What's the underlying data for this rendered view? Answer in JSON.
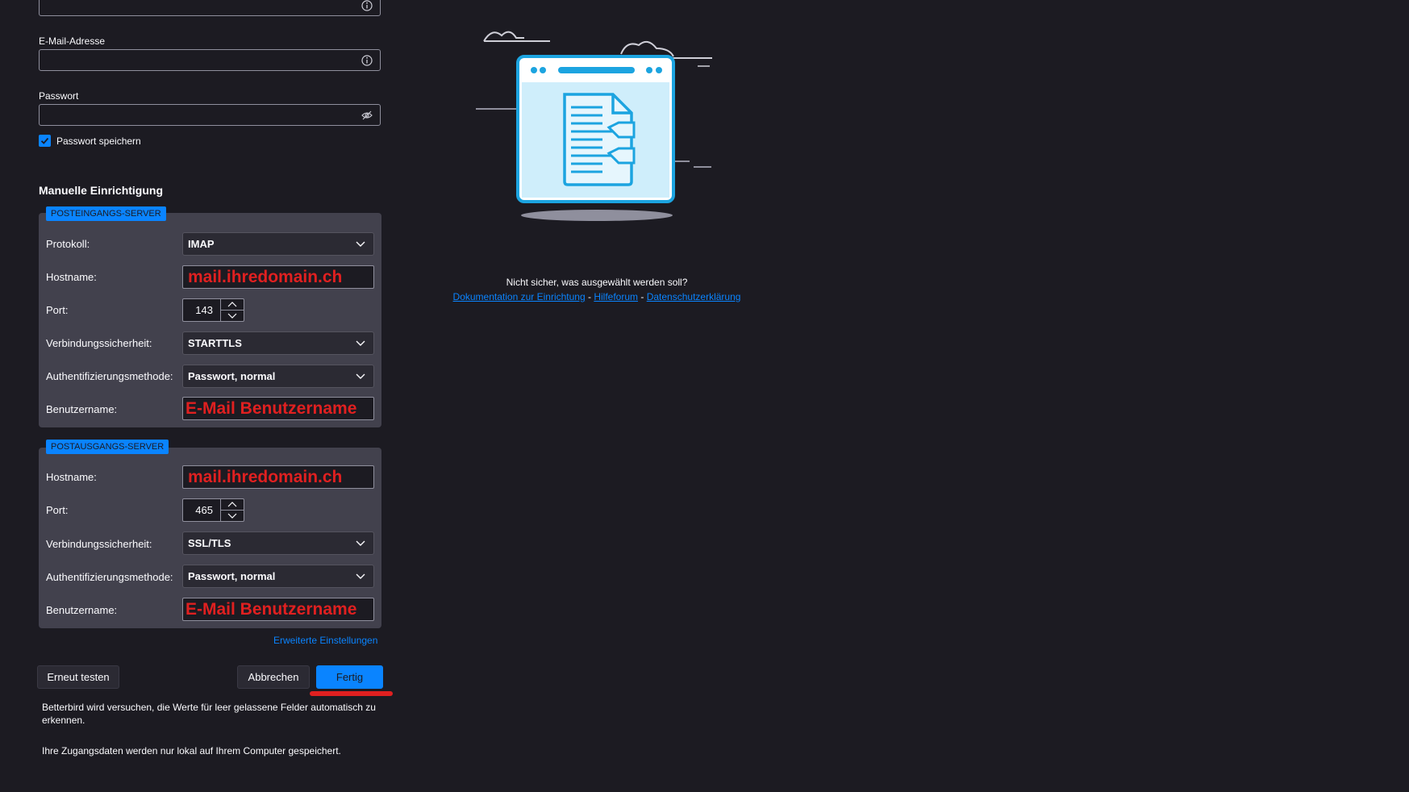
{
  "account": {
    "email_label": "E-Mail-Adresse",
    "email_value": "",
    "password_label": "Passwort",
    "password_value": "",
    "save_password_label": "Passwort speichern",
    "save_password_checked": true
  },
  "manual": {
    "title": "Manuelle Einrichtigung",
    "incoming": {
      "badge": "POSTEINGANGS-SERVER",
      "protocol_label": "Protokoll:",
      "protocol_value": "IMAP",
      "hostname_label": "Hostname:",
      "hostname_value": "mail.ihredomain.ch",
      "port_label": "Port:",
      "port_value": "143",
      "security_label": "Verbindungssicherheit:",
      "security_value": "STARTTLS",
      "auth_label": "Authentifizierungsmethode:",
      "auth_value": "Passwort, normal",
      "username_label": "Benutzername:",
      "username_value": "E-Mail Benutzername"
    },
    "outgoing": {
      "badge": "POSTAUSGANGS-SERVER",
      "hostname_label": "Hostname:",
      "hostname_value": "mail.ihredomain.ch",
      "port_label": "Port:",
      "port_value": "465",
      "security_label": "Verbindungssicherheit:",
      "security_value": "SSL/TLS",
      "auth_label": "Authentifizierungsmethode:",
      "auth_value": "Passwort, normal",
      "username_label": "Benutzername:",
      "username_value": "E-Mail Benutzername"
    },
    "advanced_link": "Erweiterte Einstellungen"
  },
  "buttons": {
    "retest": "Erneut testen",
    "cancel": "Abbrechen",
    "done": "Fertig"
  },
  "notes": {
    "autodetect": "Betterbird wird versuchen, die Werte für leer gelassene Felder automatisch zu erkennen.",
    "local": "Ihre Zugangsdaten werden nur lokal auf Ihrem Computer gespeichert."
  },
  "help": {
    "question": "Nicht sicher, was ausgewählt werden soll?",
    "doc_link": "Dokumentation zur Einrichtung",
    "sep": "-",
    "forum_link": "Hilfeforum",
    "privacy_link": "Datenschutzerklärung"
  },
  "icons": {
    "info": "info-icon",
    "eye": "eye-slash-icon",
    "check": "checkmark-icon",
    "chevron": "chevron-down-icon"
  },
  "colors": {
    "accent": "#0a84ff",
    "highlight": "#e02020",
    "background": "#1c1b22"
  }
}
